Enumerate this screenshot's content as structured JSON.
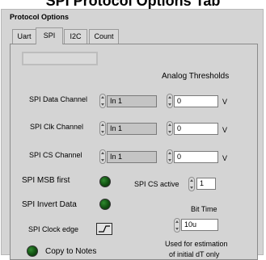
{
  "heading": "SPI Protocol Options Tab",
  "panel_title": "Protocol Options",
  "tabs": [
    {
      "label": "Uart"
    },
    {
      "label": "SPI"
    },
    {
      "label": "I2C"
    },
    {
      "label": "Count"
    }
  ],
  "active_tab": "SPI",
  "analog_thresholds": {
    "label": "Analog Thresholds",
    "unit": "V",
    "values": [
      "0",
      "0",
      "0"
    ]
  },
  "channels": [
    {
      "label": "SPI Data Channel",
      "value": "In 1"
    },
    {
      "label": "SPI Clk Channel",
      "value": "In 1"
    },
    {
      "label": "SPI CS Channel",
      "value": "In 1"
    }
  ],
  "msb_first": {
    "label": "SPI MSB first",
    "state": "on"
  },
  "invert_data": {
    "label": "SPI Invert Data",
    "state": "on"
  },
  "clock_edge": {
    "label": "SPI Clock edge",
    "icon": "rising-edge-icon"
  },
  "copy_to_notes": {
    "label": "Copy to Notes",
    "state": "on"
  },
  "cs_active": {
    "label": "SPI CS active",
    "value": "1"
  },
  "bit_time": {
    "label": "Bit Time",
    "value": "10u",
    "note_line1": "Used for estimation",
    "note_line2": "of initial dT only"
  },
  "colors": {
    "panel": "#d4d4d4",
    "led_green": "#1e6b1e",
    "field_gray": "#c4c4c4",
    "field_white": "#ffffff"
  }
}
